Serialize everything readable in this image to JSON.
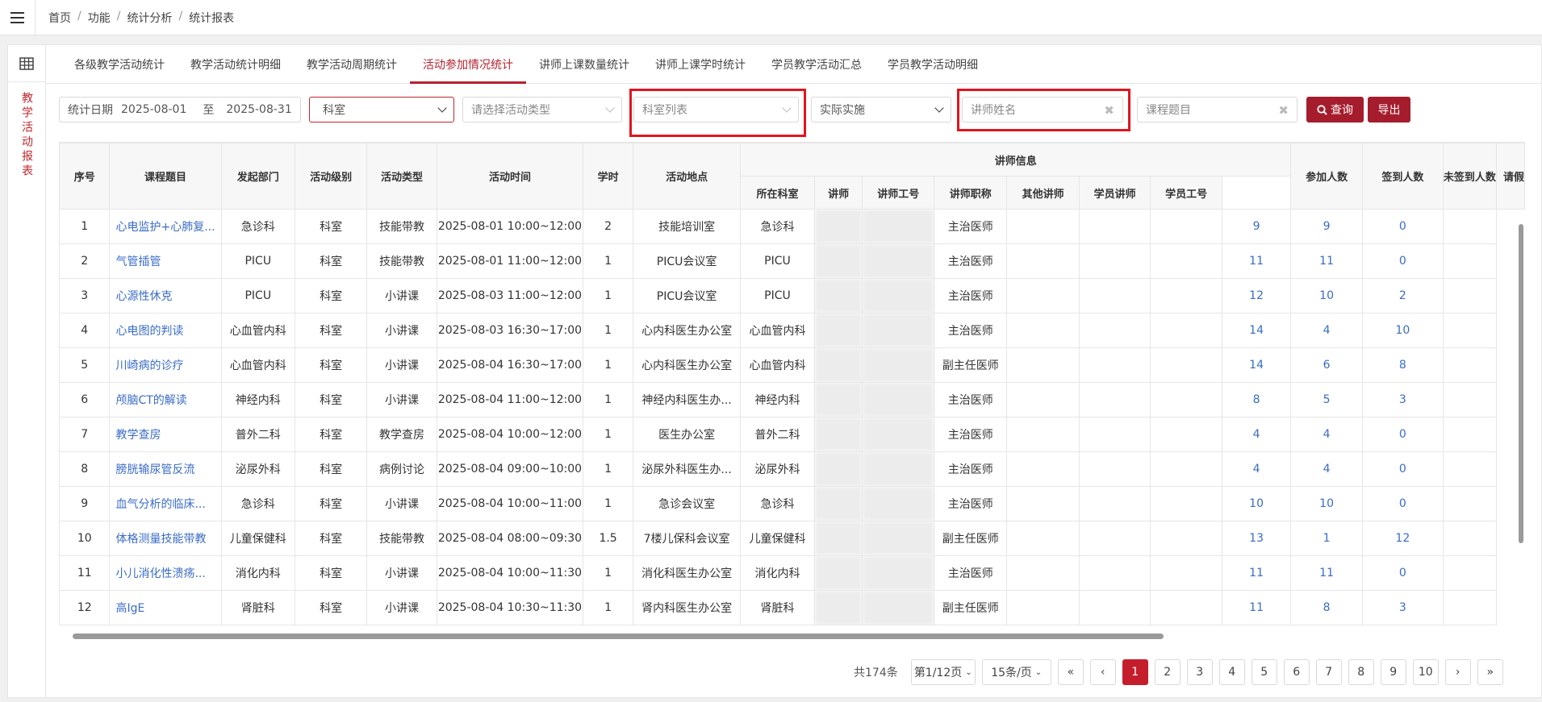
{
  "breadcrumb": [
    "首页",
    "功能",
    "统计分析",
    "统计报表"
  ],
  "sidebar_label": "教学活动报表",
  "tabs": [
    "各级教学活动统计",
    "教学活动统计明细",
    "教学活动周期统计",
    "活动参加情况统计",
    "讲师上课数量统计",
    "讲师上课学时统计",
    "学员教学活动汇总",
    "学员教学活动明细"
  ],
  "active_tab": 3,
  "filters": {
    "date_label": "统计日期",
    "date_from": "2025-08-01",
    "date_to_label": "至",
    "date_to": "2025-08-31",
    "dept_select": "科室",
    "activity_type_placeholder": "请选择活动类型",
    "dept_list_placeholder": "科室列表",
    "implement_select": "实际实施",
    "teacher_name_placeholder": "讲师姓名",
    "course_title_placeholder": "课程题目",
    "query_label": "查询",
    "export_label": "导出"
  },
  "table": {
    "headers": {
      "seq": "序号",
      "title": "课程题目",
      "dept": "发起部门",
      "level": "活动级别",
      "type": "活动类型",
      "time": "活动时间",
      "hours": "学时",
      "place": "活动地点",
      "teacher_group": "讲师信息",
      "t_dept": "所在科室",
      "teacher": "讲师",
      "t_id": "讲师工号",
      "t_title": "讲师职称",
      "other": "其他讲师",
      "stu_teacher": "学员讲师",
      "stu_id": "学员工号",
      "joined": "参加人数",
      "signed": "签到人数",
      "unsigned": "未签到人数",
      "more": "请假"
    },
    "rows": [
      {
        "seq": "1",
        "title": "心电监护+心肺复...",
        "dept": "急诊科",
        "level": "科室",
        "type": "技能带教",
        "time": "2025-08-01 10:00~12:00",
        "hours": "2",
        "place": "技能培训室",
        "t_dept": "急诊科",
        "t_title": "主治医师",
        "joined": "9",
        "signed": "9",
        "unsigned": "0"
      },
      {
        "seq": "2",
        "title": "气管插管",
        "dept": "PICU",
        "level": "科室",
        "type": "技能带教",
        "time": "2025-08-01 11:00~12:00",
        "hours": "1",
        "place": "PICU会议室",
        "t_dept": "PICU",
        "t_title": "主治医师",
        "joined": "11",
        "signed": "11",
        "unsigned": "0"
      },
      {
        "seq": "3",
        "title": "心源性休克",
        "dept": "PICU",
        "level": "科室",
        "type": "小讲课",
        "time": "2025-08-03 11:00~12:00",
        "hours": "1",
        "place": "PICU会议室",
        "t_dept": "PICU",
        "t_title": "主治医师",
        "joined": "12",
        "signed": "10",
        "unsigned": "2"
      },
      {
        "seq": "4",
        "title": "心电图的判读",
        "dept": "心血管内科",
        "level": "科室",
        "type": "小讲课",
        "time": "2025-08-03 16:30~17:00",
        "hours": "1",
        "place": "心内科医生办公室",
        "t_dept": "心血管内科",
        "t_title": "主治医师",
        "joined": "14",
        "signed": "4",
        "unsigned": "10"
      },
      {
        "seq": "5",
        "title": "川崎病的诊疗",
        "dept": "心血管内科",
        "level": "科室",
        "type": "小讲课",
        "time": "2025-08-04 16:30~17:00",
        "hours": "1",
        "place": "心内科医生办公室",
        "t_dept": "心血管内科",
        "t_title": "副主任医师",
        "joined": "14",
        "signed": "6",
        "unsigned": "8"
      },
      {
        "seq": "6",
        "title": "颅脑CT的解读",
        "dept": "神经内科",
        "level": "科室",
        "type": "小讲课",
        "time": "2025-08-04 11:00~12:00",
        "hours": "1",
        "place": "神经内科医生办...",
        "t_dept": "神经内科",
        "t_title": "主治医师",
        "joined": "8",
        "signed": "5",
        "unsigned": "3"
      },
      {
        "seq": "7",
        "title": "教学查房",
        "dept": "普外二科",
        "level": "科室",
        "type": "教学查房",
        "time": "2025-08-04 10:00~12:00",
        "hours": "1",
        "place": "医生办公室",
        "t_dept": "普外二科",
        "t_title": "主治医师",
        "joined": "4",
        "signed": "4",
        "unsigned": "0"
      },
      {
        "seq": "8",
        "title": "膀胱输尿管反流",
        "dept": "泌尿外科",
        "level": "科室",
        "type": "病例讨论",
        "time": "2025-08-04 09:00~10:00",
        "hours": "1",
        "place": "泌尿外科医生办...",
        "t_dept": "泌尿外科",
        "t_title": "主治医师",
        "joined": "4",
        "signed": "4",
        "unsigned": "0"
      },
      {
        "seq": "9",
        "title": "血气分析的临床...",
        "dept": "急诊科",
        "level": "科室",
        "type": "小讲课",
        "time": "2025-08-04 10:00~11:00",
        "hours": "1",
        "place": "急诊会议室",
        "t_dept": "急诊科",
        "t_title": "主治医师",
        "joined": "10",
        "signed": "10",
        "unsigned": "0"
      },
      {
        "seq": "10",
        "title": "体格测量技能带教",
        "dept": "儿童保健科",
        "level": "科室",
        "type": "技能带教",
        "time": "2025-08-04 08:00~09:30",
        "hours": "1.5",
        "place": "7楼儿保科会议室",
        "t_dept": "儿童保健科",
        "t_title": "副主任医师",
        "joined": "13",
        "signed": "1",
        "unsigned": "12"
      },
      {
        "seq": "11",
        "title": "小儿消化性溃疡...",
        "dept": "消化内科",
        "level": "科室",
        "type": "小讲课",
        "time": "2025-08-04 10:00~11:30",
        "hours": "1",
        "place": "消化科医生办公室",
        "t_dept": "消化内科",
        "t_title": "主治医师",
        "joined": "11",
        "signed": "11",
        "unsigned": "0"
      },
      {
        "seq": "12",
        "title": "高IgE",
        "dept": "肾脏科",
        "level": "科室",
        "type": "小讲课",
        "time": "2025-08-04 10:30~11:30",
        "hours": "1",
        "place": "肾内科医生办公室",
        "t_dept": "肾脏科",
        "t_title": "副主任医师",
        "joined": "11",
        "signed": "8",
        "unsigned": "3"
      }
    ]
  },
  "pager": {
    "total": "共174条",
    "page_select": "第1/12页",
    "size_select": "15条/页",
    "first": "«",
    "prev": "‹",
    "next": "›",
    "last": "»",
    "pages": [
      "1",
      "2",
      "3",
      "4",
      "5",
      "6",
      "7",
      "8",
      "9",
      "10"
    ],
    "current": "1"
  },
  "colors": {
    "accent": "#b4222f",
    "link": "#3a6cc7",
    "highlight_box": "#e2141e"
  }
}
